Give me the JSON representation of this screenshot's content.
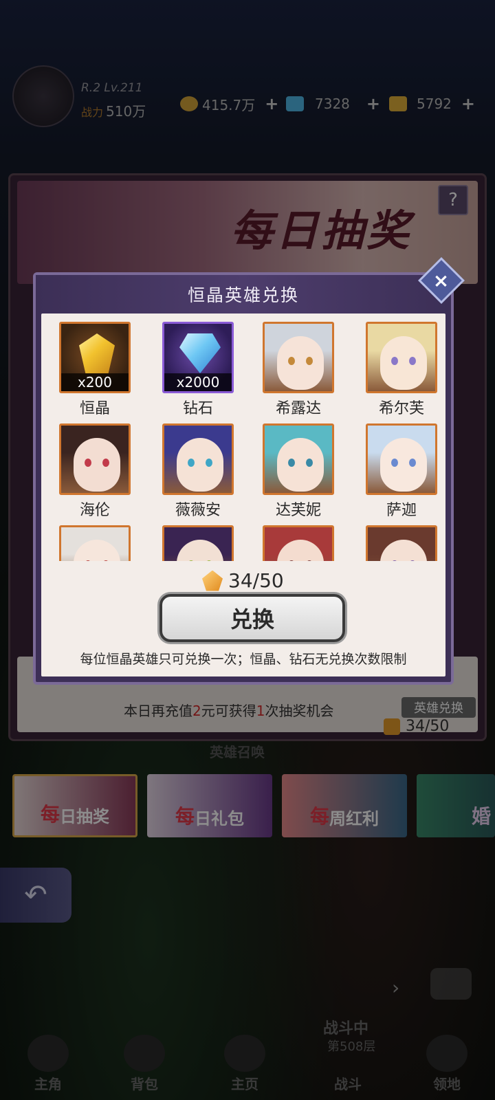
{
  "player": {
    "rank_level": "R.2 Lv.211",
    "power_label": "战力",
    "power_value": "510万"
  },
  "resources": [
    {
      "icon": "gold-coin-icon",
      "value": "415.7万",
      "color": "#d4a53a"
    },
    {
      "icon": "blue-gem-icon",
      "value": "7328",
      "color": "#4fb6e6"
    },
    {
      "icon": "ticket-icon",
      "value": "5792",
      "color": "#e0b03a"
    }
  ],
  "lottery": {
    "title": "每日抽奖",
    "help_label": "?",
    "hero_exchange_tag": "英雄兑换",
    "recharge_note_pre": "本日再充值",
    "recharge_amount": "2",
    "recharge_note_mid": "元可获得",
    "recharge_times": "1",
    "recharge_note_post": "次抽奖机会",
    "shard_count": "34/50",
    "hero_banner_label": "英雄召唤"
  },
  "modal": {
    "title": "恒晶英雄兑换",
    "items": [
      {
        "name": "恒晶",
        "qty": "x200",
        "kind": "crystal"
      },
      {
        "name": "钻石",
        "qty": "x2000",
        "kind": "diamond"
      },
      {
        "name": "希露达",
        "qty": "",
        "kind": "hero",
        "hair": "#cfd4dc",
        "skin": "#f6e3d8",
        "eye": "#c4893a"
      },
      {
        "name": "希尔芙",
        "qty": "",
        "kind": "hero",
        "hair": "#e9d9a3",
        "skin": "#f8e6d6",
        "eye": "#8a78c8"
      },
      {
        "name": "海伦",
        "qty": "",
        "kind": "hero",
        "hair": "#3a2420",
        "skin": "#f3ddd2",
        "eye": "#c23a4a"
      },
      {
        "name": "薇薇安",
        "qty": "",
        "kind": "hero",
        "hair": "#3b3a8e",
        "skin": "#f5e2d6",
        "eye": "#3fa6c6"
      },
      {
        "name": "达芙妮",
        "qty": "",
        "kind": "hero",
        "hair": "#5ab9c4",
        "skin": "#f6e2d6",
        "eye": "#3a8aa6"
      },
      {
        "name": "萨迦",
        "qty": "",
        "kind": "hero",
        "hair": "#c9dbee",
        "skin": "#f8e8de",
        "eye": "#6a8ad0"
      },
      {
        "name": "",
        "qty": "",
        "kind": "hero",
        "hair": "#e4e0dc",
        "skin": "#f6e6dc",
        "eye": "#b43a3a"
      },
      {
        "name": "",
        "qty": "",
        "kind": "hero",
        "hair": "#3a2452",
        "skin": "#f2e0d4",
        "eye": "#9ab43a"
      },
      {
        "name": "",
        "qty": "",
        "kind": "hero",
        "hair": "#a83a3a",
        "skin": "#f4dccf",
        "eye": "#7a3a3a"
      },
      {
        "name": "",
        "qty": "",
        "kind": "hero",
        "hair": "#6a3a2e",
        "skin": "#f4e0d4",
        "eye": "#7a5aa6"
      }
    ],
    "shard_count": "34/50",
    "exchange_button": "兑换",
    "note": "每位恒晶英雄只可兑换一次；恒晶、钻石无兑换次数限制"
  },
  "tabs": [
    {
      "first_char": "每",
      "rest": "日抽奖",
      "active": true
    },
    {
      "first_char": "每",
      "rest": "日礼包",
      "active": false
    },
    {
      "first_char": "每",
      "rest": "周红利",
      "active": false
    },
    {
      "first_char": "婚",
      "rest": "",
      "active": false
    }
  ],
  "bottom_nav": [
    {
      "label": "主角"
    },
    {
      "label": "背包"
    },
    {
      "label": "主页"
    },
    {
      "label": "战斗"
    },
    {
      "label": "领地"
    }
  ],
  "battle_status": {
    "title": "战斗中",
    "floor": "第508层"
  }
}
